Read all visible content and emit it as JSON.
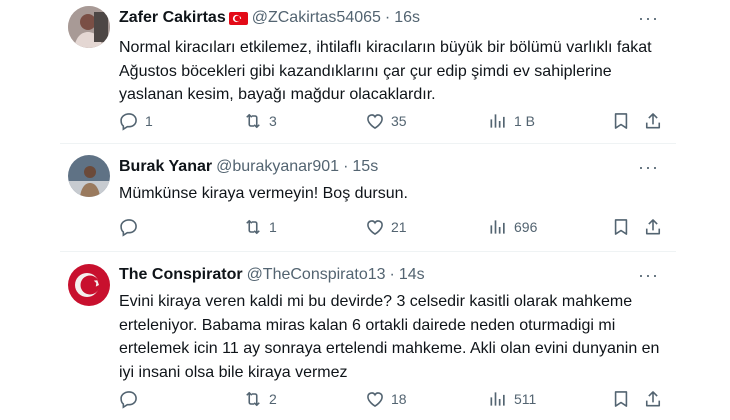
{
  "tweets": [
    {
      "name": "Zafer Cakirtas",
      "has_flag": true,
      "handle": "@ZCakirtas54065",
      "time": "16s",
      "text_lines": [
        "Normal kiracıları etkilemez, ihtilaflı kiracıların büyük bir bölümü varlıklı fakat",
        "Ağustos böcekleri gibi kazandıklarını çar çur edip şimdi ev sahiplerine",
        "yaslanan kesim, bayağı mağdur olacaklardır."
      ],
      "replies": "1",
      "retweets": "3",
      "likes": "35",
      "views": "1 B"
    },
    {
      "name": "Burak Yanar",
      "has_flag": false,
      "handle": "@burakyanar901",
      "time": "15s",
      "text_lines": [
        "Mümkünse kiraya vermeyin! Boş dursun."
      ],
      "replies": "",
      "retweets": "1",
      "likes": "21",
      "views": "696"
    },
    {
      "name": "The Conspirator",
      "has_flag": false,
      "handle": "@TheConspirato13",
      "time": "14s",
      "text_lines": [
        "Evini kiraya veren kaldi mi bu devirde? 3 celsedir kasitli olarak mahkeme",
        "erteleniyor. Babama miras kalan 6 ortakli dairede neden oturmadigi mi",
        "ertelemek icin 11 ay sonraya ertelendi mahkeme. Akli olan evini dunyanin en",
        "iyi insani olsa bile kiraya vermez"
      ],
      "replies": "",
      "retweets": "2",
      "likes": "18",
      "views": "511"
    }
  ],
  "dot_separator": "·",
  "more_glyph": "···",
  "icons": [
    "reply-icon",
    "retweet-icon",
    "like-icon",
    "views-icon",
    "bookmark-icon",
    "share-icon"
  ],
  "colors": {
    "text": "#0f1419",
    "muted": "#536471",
    "divider": "#eff3f4",
    "flag_red": "#e30a17"
  }
}
